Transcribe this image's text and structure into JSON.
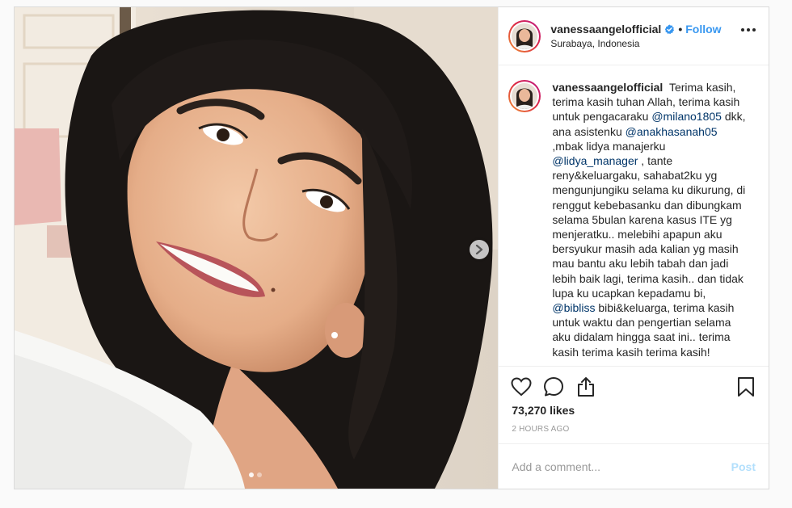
{
  "post": {
    "username": "vanessaangelofficial",
    "verified": true,
    "separator": "•",
    "follow_label": "Follow",
    "location": "Surabaya, Indonesia",
    "more_icon": "more-horizontal-icon",
    "carousel": {
      "next_icon": "chevron-right-icon",
      "slide_count": 2,
      "active_slide": 1
    }
  },
  "caption": {
    "username": "vanessaangelofficial",
    "segments": [
      {
        "type": "text",
        "value": " Terima kasih, terima kasih tuhan Allah, terima kasih untuk pengacaraku "
      },
      {
        "type": "mention",
        "value": "@milano1805"
      },
      {
        "type": "text",
        "value": " dkk, ana asistenku "
      },
      {
        "type": "mention",
        "value": "@anakhasanah05"
      },
      {
        "type": "text",
        "value": " ,mbak lidya manajerku "
      },
      {
        "type": "mention",
        "value": "@lidya_manager"
      },
      {
        "type": "text",
        "value": " , tante reny&keluargaku, sahabat2ku yg mengunjungiku selama ku dikurung, di renggut kebebasanku dan dibungkam selama 5bulan karena kasus ITE yg menjeratku.. melebihi apapun aku bersyukur masih ada kalian yg masih mau bantu aku lebih tabah dan jadi lebih baik lagi, terima kasih.. dan tidak lupa ku ucapkan kepadamu bi, "
      },
      {
        "type": "mention",
        "value": "@bibliss"
      },
      {
        "type": "text",
        "value": " bibi&keluarga, terima kasih untuk waktu dan pengertian selama aku didalam hingga saat ini.. terima kasih terima kasih terima kasih!"
      }
    ]
  },
  "actions": {
    "like_icon": "heart-icon",
    "comment_icon": "comment-icon",
    "share_icon": "share-icon",
    "save_icon": "bookmark-icon",
    "likes_text": "73,270 likes",
    "timestamp": "2 HOURS AGO"
  },
  "comment": {
    "placeholder": "Add a comment...",
    "post_label": "Post"
  },
  "colors": {
    "accent": "#3897f0",
    "mention": "#003569",
    "post_disabled": "#b2dffc",
    "verified": "#3897f0"
  }
}
